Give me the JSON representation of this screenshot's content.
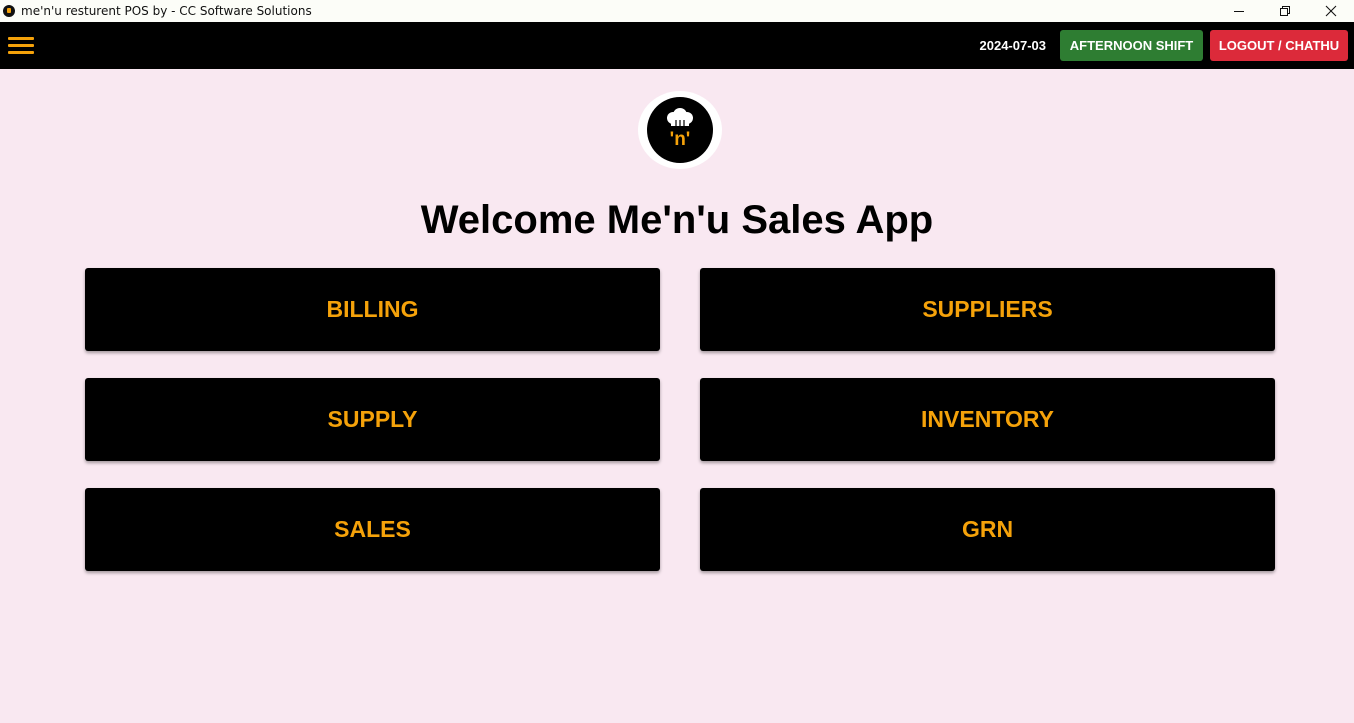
{
  "window": {
    "title": "me'n'u resturent POS by - CC Software Solutions"
  },
  "header": {
    "date": "2024-07-03",
    "shift_label": "AFTERNOON SHIFT",
    "logout_label": "LOGOUT / CHATHU"
  },
  "main": {
    "welcome": "Welcome Me'n'u Sales App",
    "logo_text": "'n'",
    "tiles": [
      {
        "label": "BILLING"
      },
      {
        "label": "SUPPLIERS"
      },
      {
        "label": "SUPPLY"
      },
      {
        "label": "INVENTORY"
      },
      {
        "label": "SALES"
      },
      {
        "label": "GRN"
      }
    ]
  },
  "icons": {
    "menu": "hamburger-menu-icon",
    "logo": "chef-hat-logo-icon",
    "minimize": "minimize-icon",
    "restore": "restore-icon",
    "close": "close-icon"
  },
  "colors": {
    "background": "#f9e8f1",
    "appbar": "#000000",
    "accent": "#f5a20a",
    "shift_button": "#2e7d32",
    "logout_button": "#dc2a3a"
  }
}
